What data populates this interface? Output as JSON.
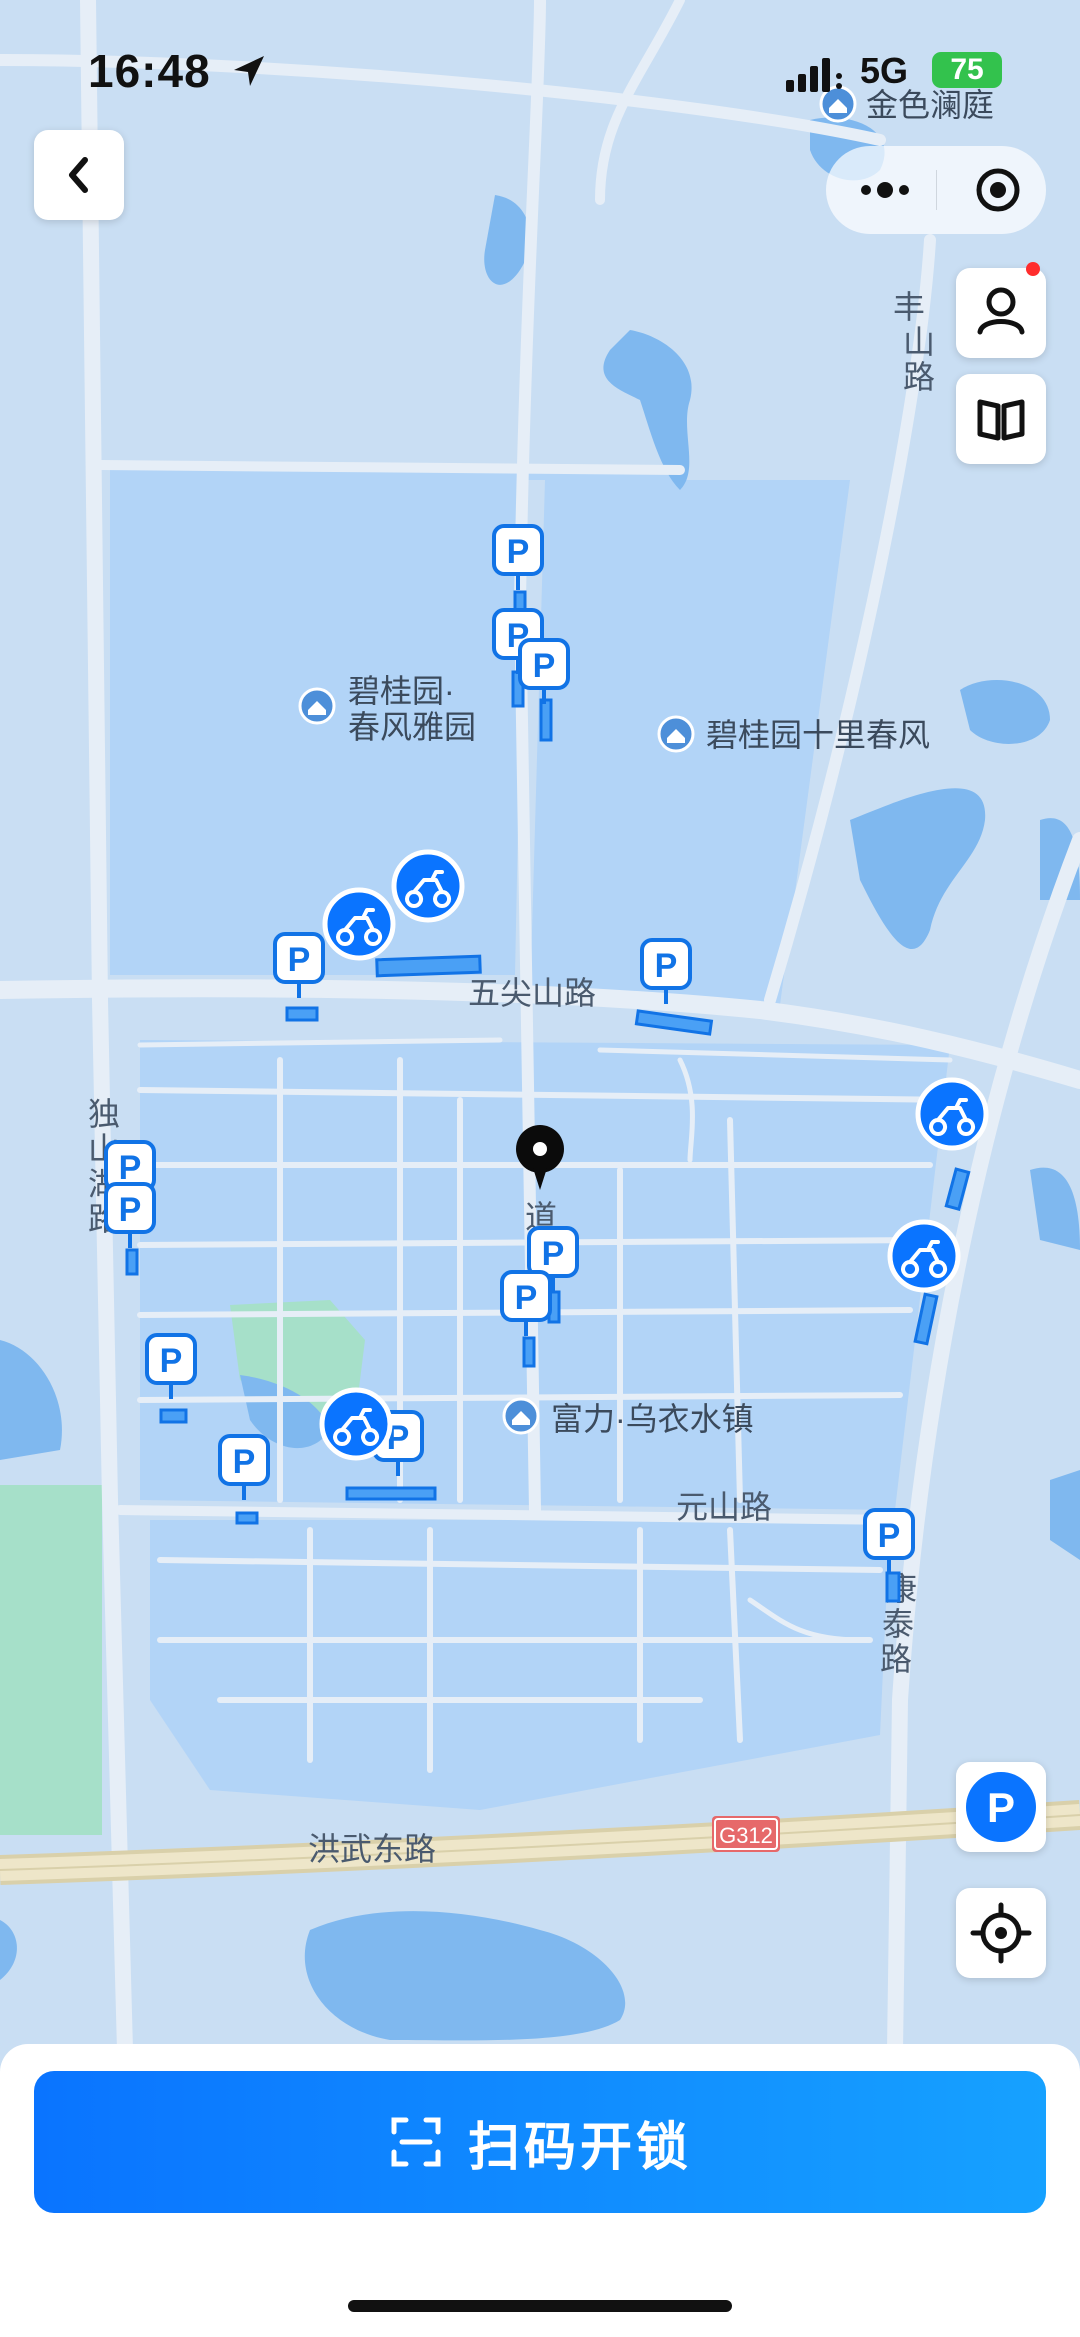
{
  "status_bar": {
    "time": "16:48",
    "network": "5G",
    "battery": "75"
  },
  "map": {
    "pois": [
      {
        "name": "金色澜庭",
        "id": "poi-jinse"
      },
      {
        "name": "碧桂园·",
        "name2": "春风雅园",
        "id": "poi-bgy-cfyy"
      },
      {
        "name": "碧桂园十里春风",
        "id": "poi-bgy-slcf"
      },
      {
        "name": "富力·乌衣水镇",
        "id": "poi-fuli"
      }
    ],
    "roads": {
      "wujianshan": "五尖山路",
      "yuanshan": "元山路",
      "hongwu": "洪武东路",
      "g312": "G312",
      "dushan_1": "独",
      "dushan_2": "山",
      "dushan_3": "湖",
      "dushan_4": "路",
      "fengshan_1": "丰",
      "fengshan_2": "山",
      "fengshan_3": "路",
      "kangtai_1": "康",
      "kangtai_2": "泰",
      "kangtai_3": "路",
      "dao": "道"
    },
    "marker_symbols": {
      "parking": "P"
    }
  },
  "buttons": {
    "scan_label": "扫码开锁",
    "parking_label": "P"
  },
  "colors": {
    "map_bg": "#c9def3",
    "zone": "#b2d4f7",
    "water": "#7fb8ef",
    "road": "#e6eef7",
    "highway": "#e3dcc0",
    "green": "#a6e0c9",
    "accent": "#0a74ff"
  },
  "icons": [
    "location-arrow-icon",
    "signal-icon",
    "back-icon",
    "more-icon",
    "target-icon",
    "user-icon",
    "book-icon",
    "parking-icon",
    "bike-icon",
    "locate-icon",
    "scan-icon",
    "pin-icon"
  ]
}
